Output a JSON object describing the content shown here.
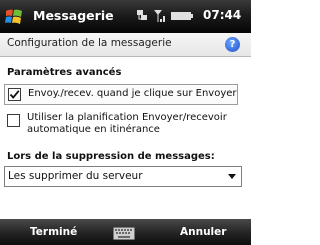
{
  "titlebar": {
    "app_title": "Messagerie",
    "time": "07:44",
    "icons": [
      "windows-start-icon",
      "connectivity-icon",
      "signal-icon",
      "battery-icon"
    ]
  },
  "subheader": {
    "title": "Configuration de la messagerie",
    "help_icon": "help-icon",
    "help_glyph": "?"
  },
  "advanced": {
    "heading": "Paramètres avancés",
    "options": [
      {
        "label": "Envoy./recev. quand je clique sur Envoyer",
        "checked": true
      },
      {
        "label": "Utiliser la planification Envoyer/recevoir automatique en itinérance",
        "checked": false
      }
    ]
  },
  "deletion": {
    "heading": "Lors de la suppression de messages:",
    "selected_option": "Les supprimer du serveur"
  },
  "softkeys": {
    "left": "Terminé",
    "center_icon": "keyboard-icon",
    "right": "Annuler"
  },
  "colors": {
    "titlebar_bg": "#1c1c1c",
    "subheader_bg": "#ececec",
    "help_blue": "#2f6bdc"
  }
}
